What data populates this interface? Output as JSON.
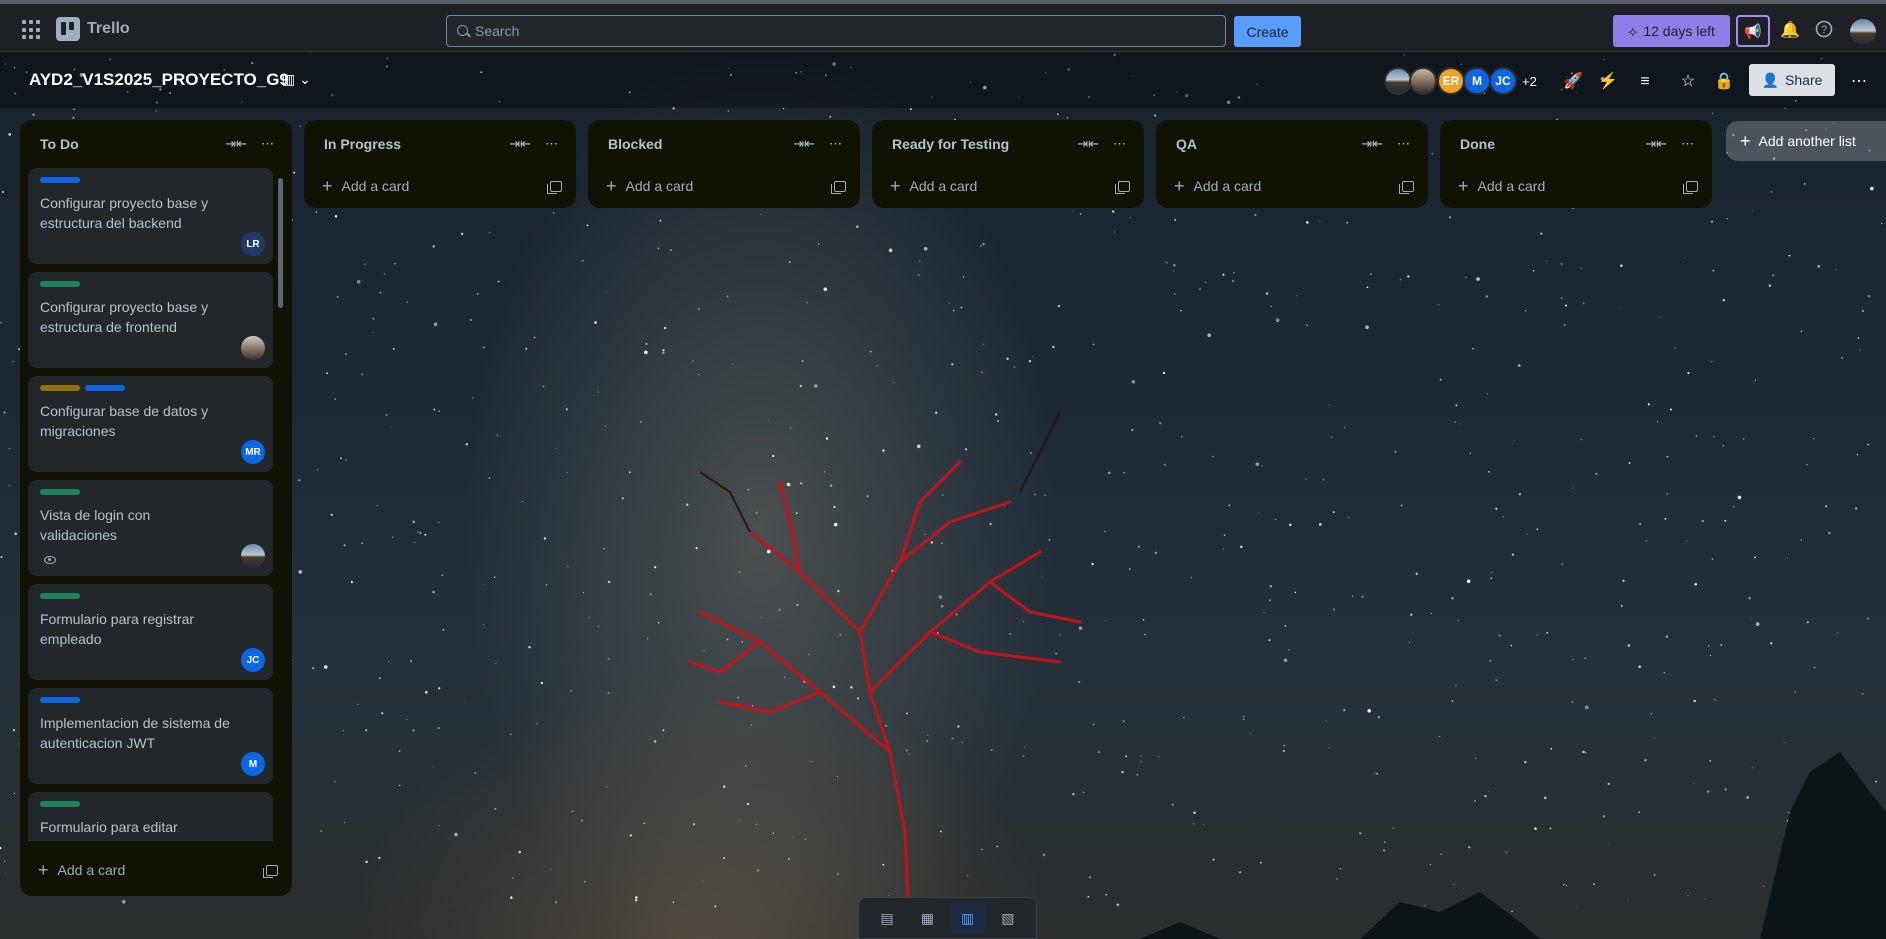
{
  "topnav": {
    "app_name": "Trello",
    "search_placeholder": "Search",
    "create_label": "Create",
    "trial_label": "12 days left"
  },
  "board": {
    "title": "AYD2_V1S2025_PROYECTO_G9",
    "members": [
      {
        "initials": "",
        "color": "#6b89a8"
      },
      {
        "initials": "",
        "color": "#4a3b30"
      },
      {
        "initials": "ER",
        "color": "#f5a02a"
      },
      {
        "initials": "M",
        "color": "#0c66e4"
      },
      {
        "initials": "JC",
        "color": "#0c66e4"
      }
    ],
    "more_members": "+2",
    "share_label": "Share"
  },
  "lists": [
    {
      "title": "To Do",
      "add_card_label": "Add a card",
      "cards": [
        {
          "title": "Configurar proyecto base y estructura del backend",
          "labels": [
            "#0c66e4"
          ],
          "avatar": "LR",
          "avatar_color": "#1f3a6b"
        },
        {
          "title": "Configurar proyecto base y estructura de frontend",
          "labels": [
            "#1f845a"
          ],
          "avatar": "",
          "avatar_color": "#4a3b30"
        },
        {
          "title": "Configurar base de datos y migraciones",
          "labels": [
            "#946f00",
            "#0c66e4"
          ],
          "avatar": "MR",
          "avatar_color": "#0c66e4"
        },
        {
          "title": "Vista de login con validaciones",
          "labels": [
            "#1f845a"
          ],
          "avatar": "",
          "avatar_color": "#6b89a8"
        },
        {
          "title": "Formulario para registrar empleado",
          "labels": [
            "#1f845a"
          ],
          "avatar": "JC",
          "avatar_color": "#0c66e4"
        },
        {
          "title": "Implementacion de sistema de autenticacion JWT",
          "labels": [
            "#0c66e4"
          ],
          "avatar": "M",
          "avatar_color": "#0c66e4"
        },
        {
          "title": "Formulario para editar empleado",
          "labels": [
            "#1f845a"
          ],
          "avatar": "",
          "avatar_color": ""
        }
      ]
    },
    {
      "title": "In Progress",
      "add_card_label": "Add a card"
    },
    {
      "title": "Blocked",
      "add_card_label": "Add a card"
    },
    {
      "title": "Ready for Testing",
      "add_card_label": "Add a card"
    },
    {
      "title": "QA",
      "add_card_label": "Add a card"
    },
    {
      "title": "Done",
      "add_card_label": "Add a card"
    }
  ],
  "add_list_label": "Add another list",
  "view_switcher": {
    "items": [
      "inbox-icon",
      "calendar-icon",
      "board-icon",
      "switch-boards-icon"
    ],
    "active": "board-icon"
  }
}
